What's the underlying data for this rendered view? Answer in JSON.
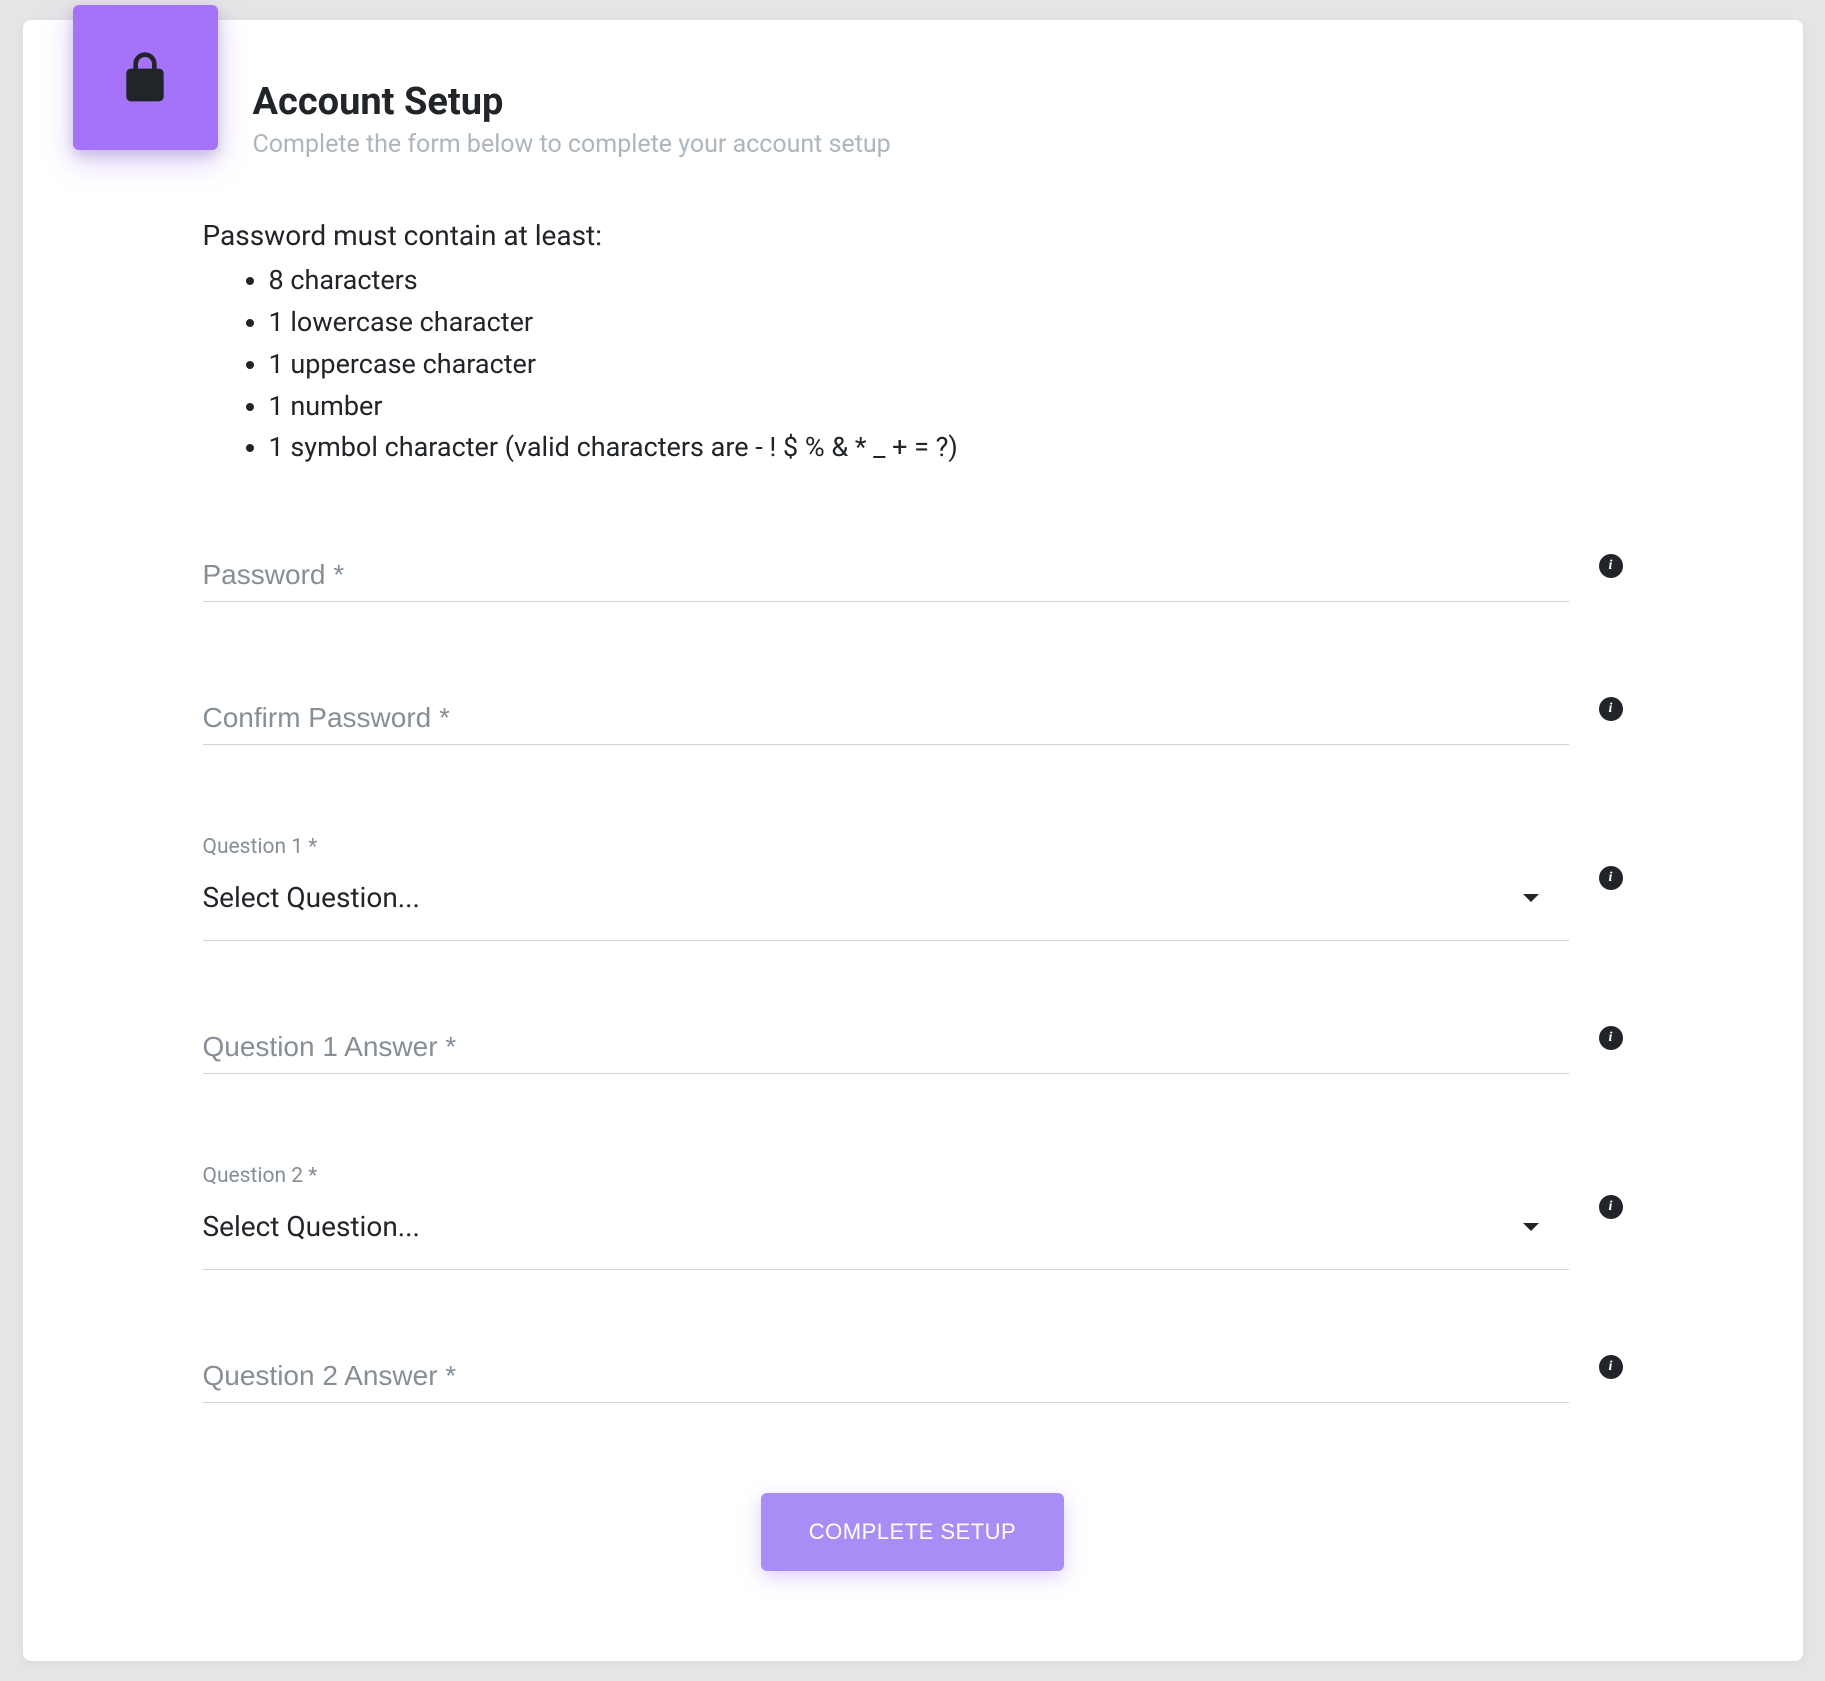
{
  "header": {
    "title": "Account Setup",
    "subtitle": "Complete the form below to complete your account setup"
  },
  "requirements": {
    "heading": "Password must contain at least:",
    "items": [
      "8 characters",
      "1 lowercase character",
      "1 uppercase character",
      "1 number",
      "1 symbol character (valid characters are - ! $ % & * _ + = ?)"
    ]
  },
  "fields": {
    "password": {
      "placeholder": "Password *",
      "value": ""
    },
    "confirm_password": {
      "placeholder": "Confirm Password *",
      "value": ""
    },
    "question1": {
      "label": "Question 1 *",
      "selected": "Select Question..."
    },
    "answer1": {
      "placeholder": "Question 1 Answer *",
      "value": ""
    },
    "question2": {
      "label": "Question 2 *",
      "selected": "Select Question..."
    },
    "answer2": {
      "placeholder": "Question 2 Answer *",
      "value": ""
    }
  },
  "button": {
    "label": "COMPLETE SETUP"
  }
}
